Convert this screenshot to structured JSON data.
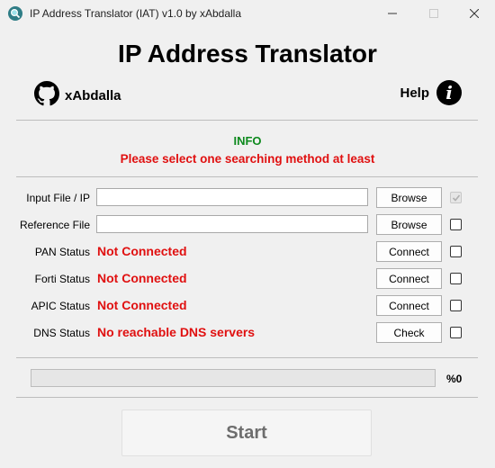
{
  "window": {
    "title": "IP Address Translator (IAT) v1.0 by xAbdalla",
    "icon": "magnifier-globe-icon",
    "controls": [
      "minimize-icon",
      "maximize-icon",
      "close-icon"
    ]
  },
  "header": {
    "title": "IP Address Translator",
    "author": "xAbdalla",
    "author_icon": "github-icon",
    "help_label": "Help",
    "help_icon": "info-icon"
  },
  "info": {
    "title": "INFO",
    "message": "Please select one searching method at least",
    "title_color": "#0e8a1e",
    "message_color": "#e01010"
  },
  "rows": [
    {
      "label": "Input File / IP",
      "value": "",
      "button": "Browse",
      "checked": true,
      "checkbox_enabled": false
    },
    {
      "label": "Reference File",
      "value": "",
      "button": "Browse",
      "checked": false,
      "checkbox_enabled": true
    },
    {
      "label": "PAN Status",
      "status": "Not Connected",
      "button": "Connect",
      "checked": false,
      "checkbox_enabled": true
    },
    {
      "label": "Forti Status",
      "status": "Not Connected",
      "button": "Connect",
      "checked": false,
      "checkbox_enabled": true
    },
    {
      "label": "APIC Status",
      "status": "Not Connected",
      "button": "Connect",
      "checked": false,
      "checkbox_enabled": true
    },
    {
      "label": "DNS Status",
      "status": "No reachable DNS servers",
      "button": "Check",
      "checked": false,
      "checkbox_enabled": true
    }
  ],
  "progress": {
    "value": 0,
    "text": "%0"
  },
  "start_label": "Start",
  "colors": {
    "error": "#e01010",
    "ok": "#0e8a1e"
  }
}
